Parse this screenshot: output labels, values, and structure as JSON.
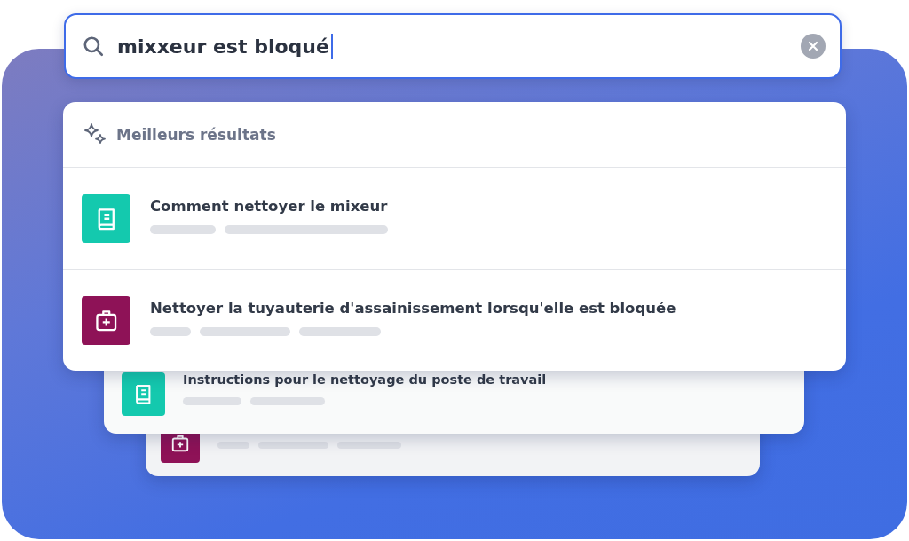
{
  "search": {
    "value": "mixxeur est bloqué",
    "focused": true
  },
  "results": {
    "header": "Meilleurs résultats",
    "items": [
      {
        "kind": "guide",
        "title": "Comment nettoyer le mixeur"
      },
      {
        "kind": "procedure",
        "title": "Nettoyer la tuyauterie d'assainissement lorsqu'elle est bloquée"
      }
    ]
  },
  "background_cards": [
    {
      "kind": "guide",
      "title": "Instructions pour le nettoyage du poste de travail"
    },
    {
      "kind": "procedure"
    }
  ]
}
